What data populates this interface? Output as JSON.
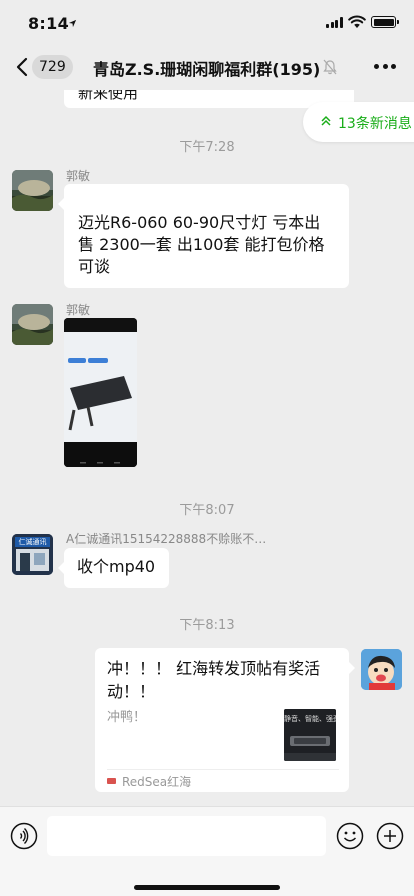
{
  "status_bar": {
    "time": "8:14",
    "location_icon": "location-arrow-icon",
    "icons": [
      "cellular-signal-icon",
      "wifi-icon",
      "battery-icon"
    ]
  },
  "nav": {
    "back_count": "729",
    "title": "青岛Z.S.珊瑚闲聊福利群(195)",
    "icons": [
      "back-chevron-icon",
      "mute-bell-icon",
      "more-dots-icon"
    ]
  },
  "chat": {
    "partial_message": "新来使用",
    "new_messages": "13条新消息",
    "time_1": "下午7:28",
    "message_1": {
      "sender": "郭敏",
      "text": "迈光R6-060   60-90尺寸灯 亏本出售 2300一套 出100套  能打包价格可谈"
    },
    "message_2": {
      "sender": "郭敏",
      "type": "image"
    },
    "time_2": "下午8:07",
    "message_3": {
      "sender": "A仁诚通讯15154228888不赊账不…",
      "avatar_text": "仁诚通讯",
      "text": "收个mp40"
    },
    "time_3": "下午8:13",
    "message_4": {
      "link_title": "冲！！！ 红海转发顶帖有奖活动！！",
      "link_desc": "冲鸭！",
      "thumb_text": "静音、智能、强劲",
      "source_logo": "RedSea",
      "source": "RedSea红海"
    }
  },
  "input_bar": {
    "icons": [
      "voice-icon",
      "emoji-icon",
      "plus-icon"
    ]
  },
  "colors": {
    "background": "#ededed",
    "accent_green": "#1aad19",
    "bubble": "#ffffff"
  }
}
